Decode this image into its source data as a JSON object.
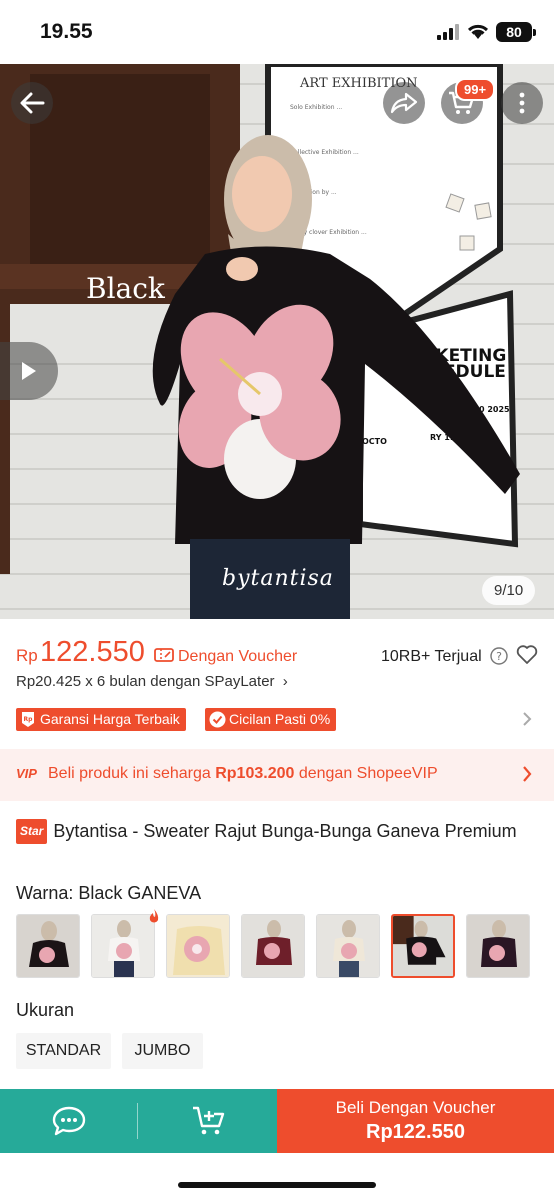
{
  "status_bar": {
    "time": "19.55",
    "battery": "80"
  },
  "hero": {
    "color_label": "Black",
    "watermark": "bytantisa",
    "image_counter": "9/10",
    "cart_badge": "99+",
    "icons": [
      "back-arrow-icon",
      "share-icon",
      "cart-icon",
      "more-icon",
      "play-icon"
    ],
    "poster_texts": {
      "art": "ART EXHIBITION",
      "ticketing_1": "TICKETING",
      "ticketing_2": "SCHEDULE",
      "date_1": "OCTOBER 30 2025",
      "date_2": "RY 11 , 2026",
      "octo": "OCTO"
    }
  },
  "price": {
    "currency": "Rp",
    "amount": "122.550",
    "voucher_label": "Dengan Voucher",
    "sold": "10RB+ Terjual",
    "paylater": "Rp20.425 x 6 bulan dengan SPayLater"
  },
  "badges": [
    {
      "label": "Garansi Harga Terbaik",
      "icon": "rp-tag-icon"
    },
    {
      "label": "Cicilan Pasti 0%",
      "icon": "check-circle-icon"
    }
  ],
  "vip": {
    "tag": "VIP",
    "text_before": "Beli produk ini seharga ",
    "price": "Rp103.200",
    "text_after": " dengan ShopeeVIP"
  },
  "product": {
    "badge": "Star",
    "title": "Bytantisa - Sweater Rajut Bunga-Bunga Ganeva Premium"
  },
  "variant": {
    "label": "Warna:",
    "value": "Black GANEVA",
    "thumbnail_count": 7,
    "selected_index": 5
  },
  "size": {
    "label": "Ukuran",
    "options": [
      "STANDAR",
      "JUMBO"
    ]
  },
  "bottom_bar": {
    "buy_line1": "Beli Dengan Voucher",
    "buy_line2": "Rp122.550"
  },
  "colors": {
    "accent": "#ee4d2d",
    "teal": "#26aa99",
    "vip_bg": "#fdf0ee"
  }
}
